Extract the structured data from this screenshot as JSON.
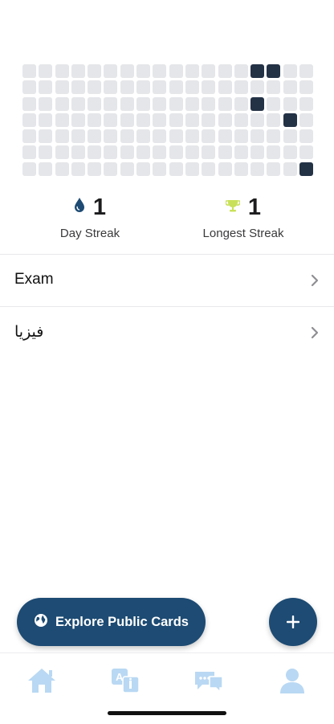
{
  "heatmap": {
    "rows": 7,
    "cols": 18,
    "active_cells": [
      [
        0,
        14
      ],
      [
        0,
        15
      ],
      [
        2,
        14
      ],
      [
        3,
        16
      ],
      [
        6,
        17
      ]
    ],
    "colors": {
      "empty": "#e5e6e9",
      "active": "#243246"
    }
  },
  "stats": {
    "day_streak": {
      "value": "1",
      "label": "Day Streak",
      "icon": "drop-icon",
      "icon_color": "#1d4b73"
    },
    "longest_streak": {
      "value": "1",
      "label": "Longest Streak",
      "icon": "trophy-icon",
      "icon_color": "#c9e05a"
    }
  },
  "decks": [
    {
      "label": "Exam"
    },
    {
      "label": "فيزيا"
    }
  ],
  "actions": {
    "explore_label": "Explore Public Cards",
    "explore_icon": "globe-icon",
    "add_icon": "plus-icon"
  },
  "tabbar": {
    "items": [
      "home-icon",
      "translate-icon",
      "chat-icon",
      "profile-icon"
    ],
    "color": "#b9d8f3"
  },
  "colors": {
    "primary": "#1d4b73"
  }
}
